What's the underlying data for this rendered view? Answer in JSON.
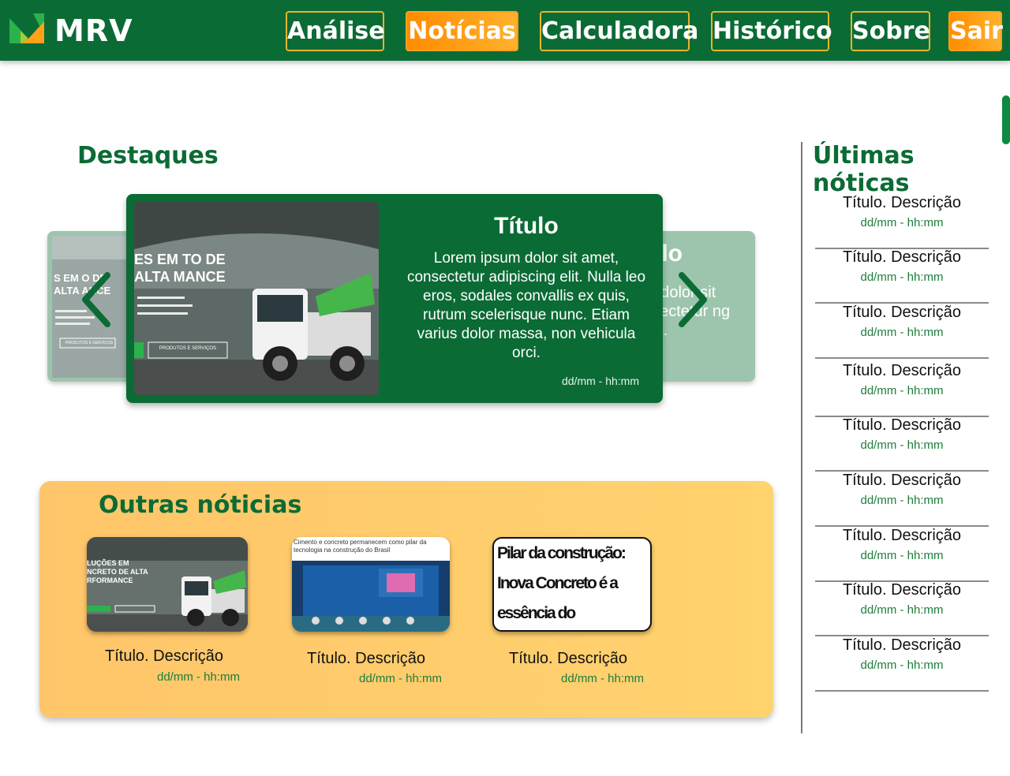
{
  "header": {
    "brand": "MRV",
    "colors": {
      "bar": "#0b6b35",
      "active": "#ff8c00",
      "outline": "#e8b32a"
    },
    "nav": [
      {
        "label": "Análise",
        "active": false
      },
      {
        "label": "Notícias",
        "active": true
      },
      {
        "label": "Calculadora",
        "active": false
      },
      {
        "label": "Histórico",
        "active": false
      },
      {
        "label": "Sobre",
        "active": false
      },
      {
        "label": "Sair",
        "active": true
      }
    ]
  },
  "highlights": {
    "title": "Destaques",
    "ghost_title": "ulo",
    "ghost_text": "m dolor sit nsectetur ng elit.",
    "card": {
      "title": "Título",
      "text": "Lorem ipsum dolor sit amet, consectetur adipiscing elit. Nulla leo eros, sodales convallis ex quis, rutrum scelerisque nunc. Etiam varius dolor massa, non vehicula orci.",
      "date": "dd/mm - hh:mm",
      "image_caption": "ES EM TO DE ALTA MANCE",
      "image_button": "PRODUTOS E SERVIÇOS",
      "image_subtext": "a obras de alto da e frota própria dade incomparáveis."
    },
    "ghost_left_caption": "S EM O DE ALTA ANCE",
    "ghost_left_button": "PRODUTOS E SERVIÇOS",
    "icons": {
      "prev": "chevron-left-icon",
      "next": "chevron-right-icon"
    }
  },
  "others": {
    "title": "Outras nóticias",
    "items": [
      {
        "title": "Título. Descrição",
        "date": "dd/mm - hh:mm",
        "image_caption": "LUÇÕES EM NCRETO DE ALTA RFORMANCE"
      },
      {
        "title": "Título. Descrição",
        "date": "dd/mm - hh:mm",
        "image_caption": "Cimento e concreto permanecem como pilar da tecnologia na construção do Brasil"
      },
      {
        "title": "Título. Descrição",
        "date": "dd/mm - hh:mm",
        "image_caption": "Pilar da construção: Inova Concreto é a essência do desenvolvimento regional"
      }
    ]
  },
  "latest": {
    "title": "Últimas nóticas",
    "items": [
      {
        "title": "Título. Descrição",
        "date": "dd/mm - hh:mm"
      },
      {
        "title": "Título. Descrição",
        "date": "dd/mm - hh:mm"
      },
      {
        "title": "Título. Descrição",
        "date": "dd/mm - hh:mm"
      },
      {
        "title": "Título. Descrição",
        "date": "dd/mm - hh:mm"
      },
      {
        "title": "Título. Descrição",
        "date": "dd/mm - hh:mm"
      },
      {
        "title": "Título. Descrição",
        "date": "dd/mm - hh:mm"
      },
      {
        "title": "Título. Descrição",
        "date": "dd/mm - hh:mm"
      },
      {
        "title": "Título. Descrição",
        "date": "dd/mm - hh:mm"
      },
      {
        "title": "Título. Descrição",
        "date": "dd/mm - hh:mm"
      }
    ]
  }
}
